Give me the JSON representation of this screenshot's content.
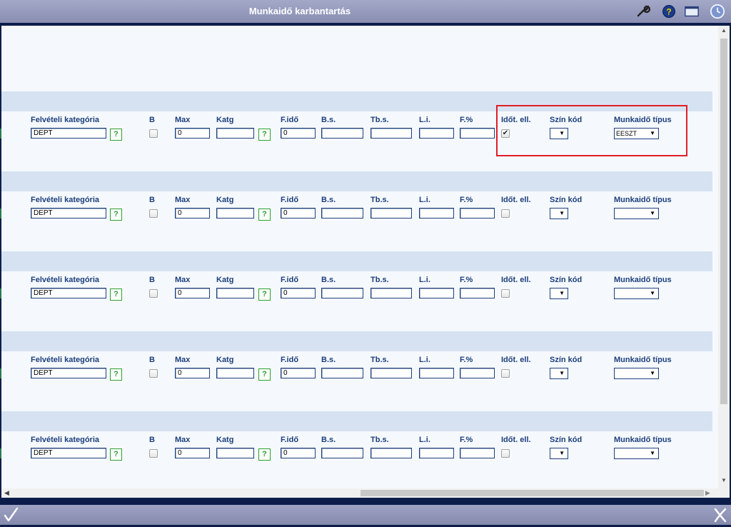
{
  "window": {
    "title": "Munkaidő karbantartás",
    "toolbar_icons": [
      "wrench-icon",
      "help-icon",
      "window-icon",
      "clock-icon"
    ]
  },
  "labels": {
    "felveteli": "Felvételi kategória",
    "b": "B",
    "max": "Max",
    "katg": "Katg",
    "fido": "F.idő",
    "bs": "B.s.",
    "tbs": "Tb.s.",
    "li": "L.i.",
    "fszazalek": "F.%",
    "idotell": "Időt. ell.",
    "szinkod": "Szín kód",
    "munkaido": "Munkaidő típus",
    "help": "?"
  },
  "rows": [
    {
      "felveteli": "DEPT",
      "b_checked": false,
      "max": "0",
      "katg": "",
      "fido": "0",
      "bs": "",
      "tbs": "",
      "li": "",
      "fszazalek": "",
      "idotell_checked": true,
      "szinkod": "",
      "munkaido": "EESZT",
      "idotell_mark": "✔"
    },
    {
      "felveteli": "DEPT",
      "b_checked": false,
      "max": "0",
      "katg": "",
      "fido": "0",
      "bs": "",
      "tbs": "",
      "li": "",
      "fszazalek": "",
      "idotell_checked": false,
      "szinkod": "",
      "munkaido": "",
      "idotell_mark": ""
    },
    {
      "felveteli": "DEPT",
      "b_checked": false,
      "max": "0",
      "katg": "",
      "fido": "0",
      "bs": "",
      "tbs": "",
      "li": "",
      "fszazalek": "",
      "idotell_checked": false,
      "szinkod": "",
      "munkaido": "",
      "idotell_mark": ""
    },
    {
      "felveteli": "DEPT",
      "b_checked": false,
      "max": "0",
      "katg": "",
      "fido": "0",
      "bs": "",
      "tbs": "",
      "li": "",
      "fszazalek": "",
      "idotell_checked": false,
      "szinkod": "",
      "munkaido": "",
      "idotell_mark": ""
    },
    {
      "felveteli": "DEPT",
      "b_checked": false,
      "max": "0",
      "katg": "",
      "fido": "0",
      "bs": "",
      "tbs": "",
      "li": "",
      "fszazalek": "",
      "idotell_checked": false,
      "szinkod": "",
      "munkaido": "",
      "idotell_mark": ""
    }
  ],
  "colors": {
    "label": "#1d3e7c",
    "band": "#d6e2f1",
    "highlight": "#e01e2a",
    "titlebar": "#9ea3c4"
  },
  "bottom": {
    "ok_icon": "checkmark-icon",
    "cancel_icon": "x-close-icon"
  }
}
